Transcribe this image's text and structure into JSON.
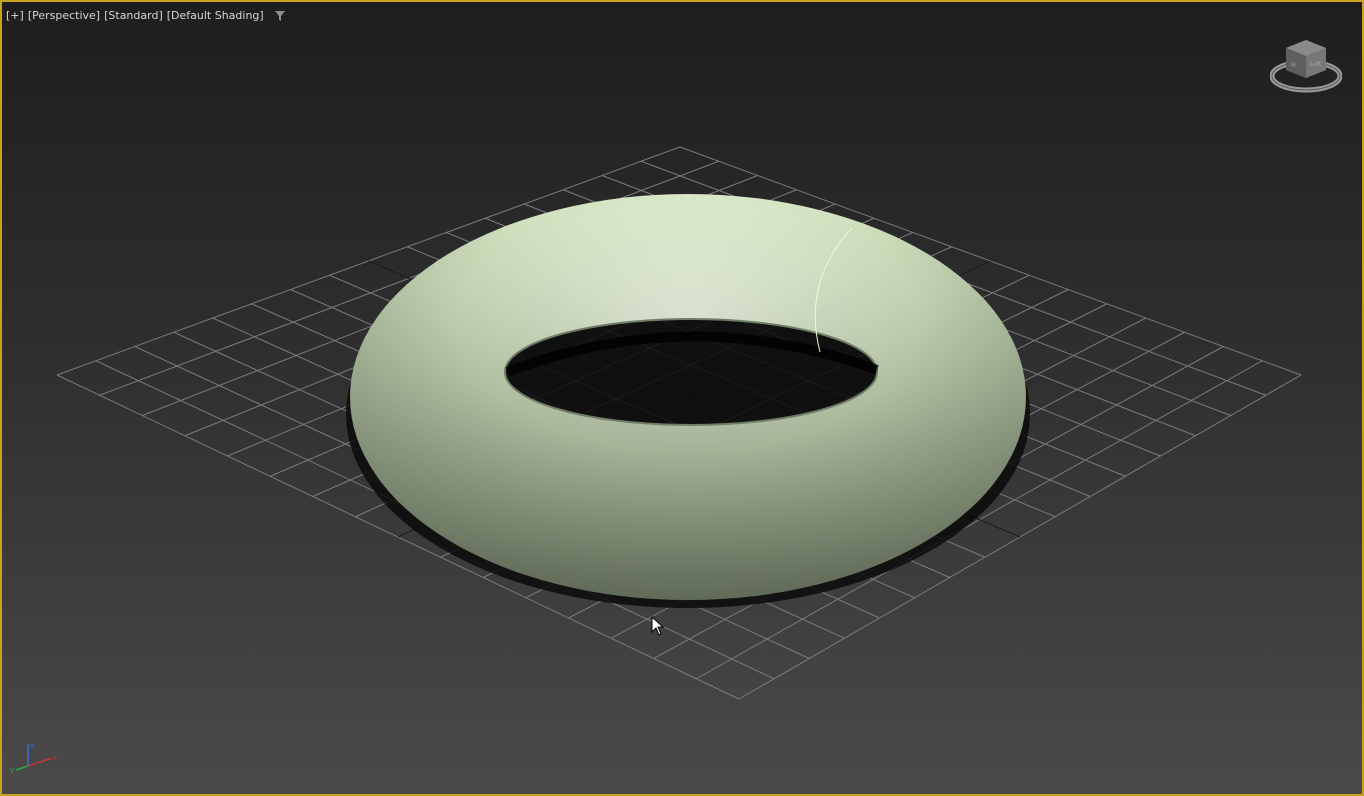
{
  "viewport": {
    "labels": {
      "menu": "[+]",
      "view": "[Perspective]",
      "mode": "[Standard]",
      "shading": "[Default Shading]"
    },
    "filter_icon": "filter-icon",
    "active_border_color": "#c9a21e"
  },
  "scene": {
    "object": "torus",
    "object_color": "#d6e7c4",
    "grid_color": "#7b7b7b",
    "axis_line_color": "#111111"
  },
  "viewcube": {
    "icon": "viewcube-icon",
    "face_labels": [
      "Fr",
      "Left"
    ]
  },
  "axis_tripod": {
    "icon": "axis-tripod-icon",
    "labels": [
      "x",
      "y",
      "z"
    ]
  },
  "cursor": {
    "icon": "mouse-cursor-icon"
  }
}
